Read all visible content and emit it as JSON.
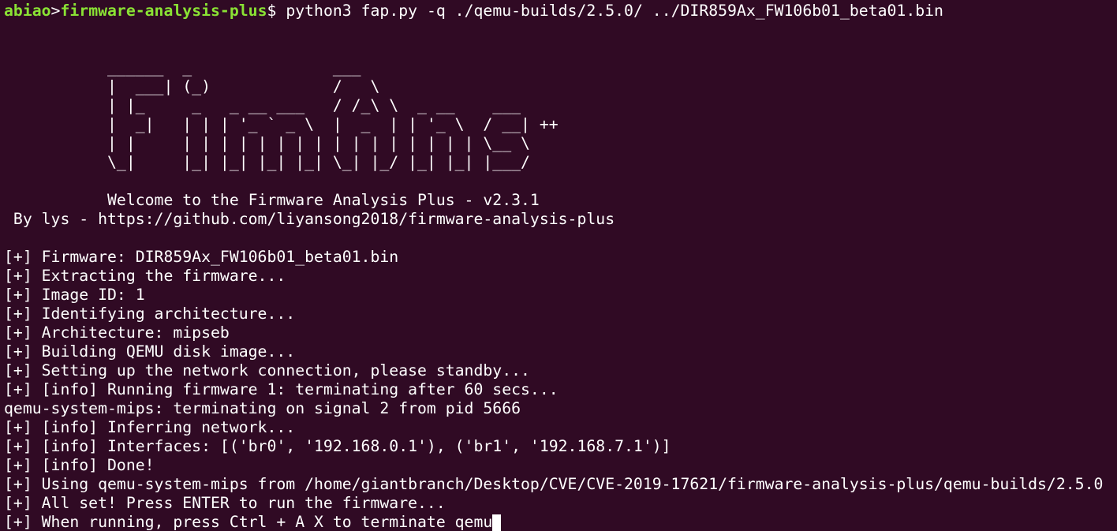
{
  "prompt": {
    "user": "abiao",
    "separator": ">",
    "directory": "firmware-analysis-plus",
    "symbol": "$",
    "command": " python3 fap.py -q ./qemu-builds/2.5.0/ ../DIR859Ax_FW106b01_beta01.bin"
  },
  "banner_lines": [
    "",
    "",
    "           ______  _               ___",
    "           |  ___| (_)             /   \\",
    "           | |_     _   _ __ ___   / /_\\ \\  _ __    ___",
    "           |  _|   | | | '_ ` _ \\  |  _  | | '_ \\  / __| ++",
    "           | |     | | | | | | | | | | | | | | | | \\__ \\",
    "           \\_|     |_| |_| |_| |_| \\_| |_/ |_| |_| |___/",
    "",
    "           Welcome to the Firmware Analysis Plus - v2.3.1",
    " By lys - https://github.com/liyansong2018/firmware-analysis-plus",
    ""
  ],
  "output_lines": [
    "[+] Firmware: DIR859Ax_FW106b01_beta01.bin",
    "[+] Extracting the firmware...",
    "[+] Image ID: 1",
    "[+] Identifying architecture...",
    "[+] Architecture: mipseb",
    "[+] Building QEMU disk image...",
    "[+] Setting up the network connection, please standby...",
    "[+] [info] Running firmware 1: terminating after 60 secs...",
    "qemu-system-mips: terminating on signal 2 from pid 5666",
    "[+] [info] Inferring network...",
    "[+] [info] Interfaces: [('br0', '192.168.0.1'), ('br1', '192.168.7.1')]",
    "[+] [info] Done!",
    "[+] Using qemu-system-mips from /home/giantbranch/Desktop/CVE/CVE-2019-17621/firmware-analysis-plus/qemu-builds/2.5.0",
    "[+] All set! Press ENTER to run the firmware..."
  ],
  "last_line": "[+] When running, press Ctrl + A X to terminate qemu",
  "colors": {
    "background": "#300a24",
    "foreground": "#ffffff",
    "prompt": "#8ae234"
  }
}
